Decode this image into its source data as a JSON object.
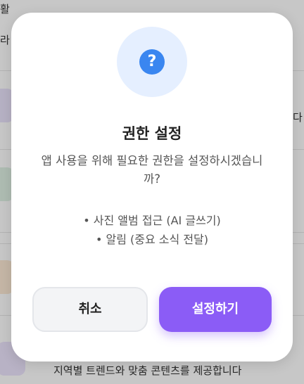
{
  "background": {
    "top_text_line1": "활",
    "top_text_line2": "라",
    "right_edge_text": "다",
    "bottom_text": "지역별 트렌드와 맞춤 콘텐츠를 제공합니다"
  },
  "dialog": {
    "icon": "question-mark-icon",
    "icon_glyph": "?",
    "title": "권한 설정",
    "message": "앱 사용을 위해 필요한 권한을 설정하시겠습니까?",
    "permissions": [
      "• 사진 앨범 접근 (AI 글쓰기)",
      "• 알림 (중요 소식 전달)"
    ],
    "cancel_label": "취소",
    "confirm_label": "설정하기"
  },
  "colors": {
    "accent": "#8b5cf6",
    "icon_blue": "#3a86f0",
    "icon_circle_bg": "#e5efff"
  }
}
